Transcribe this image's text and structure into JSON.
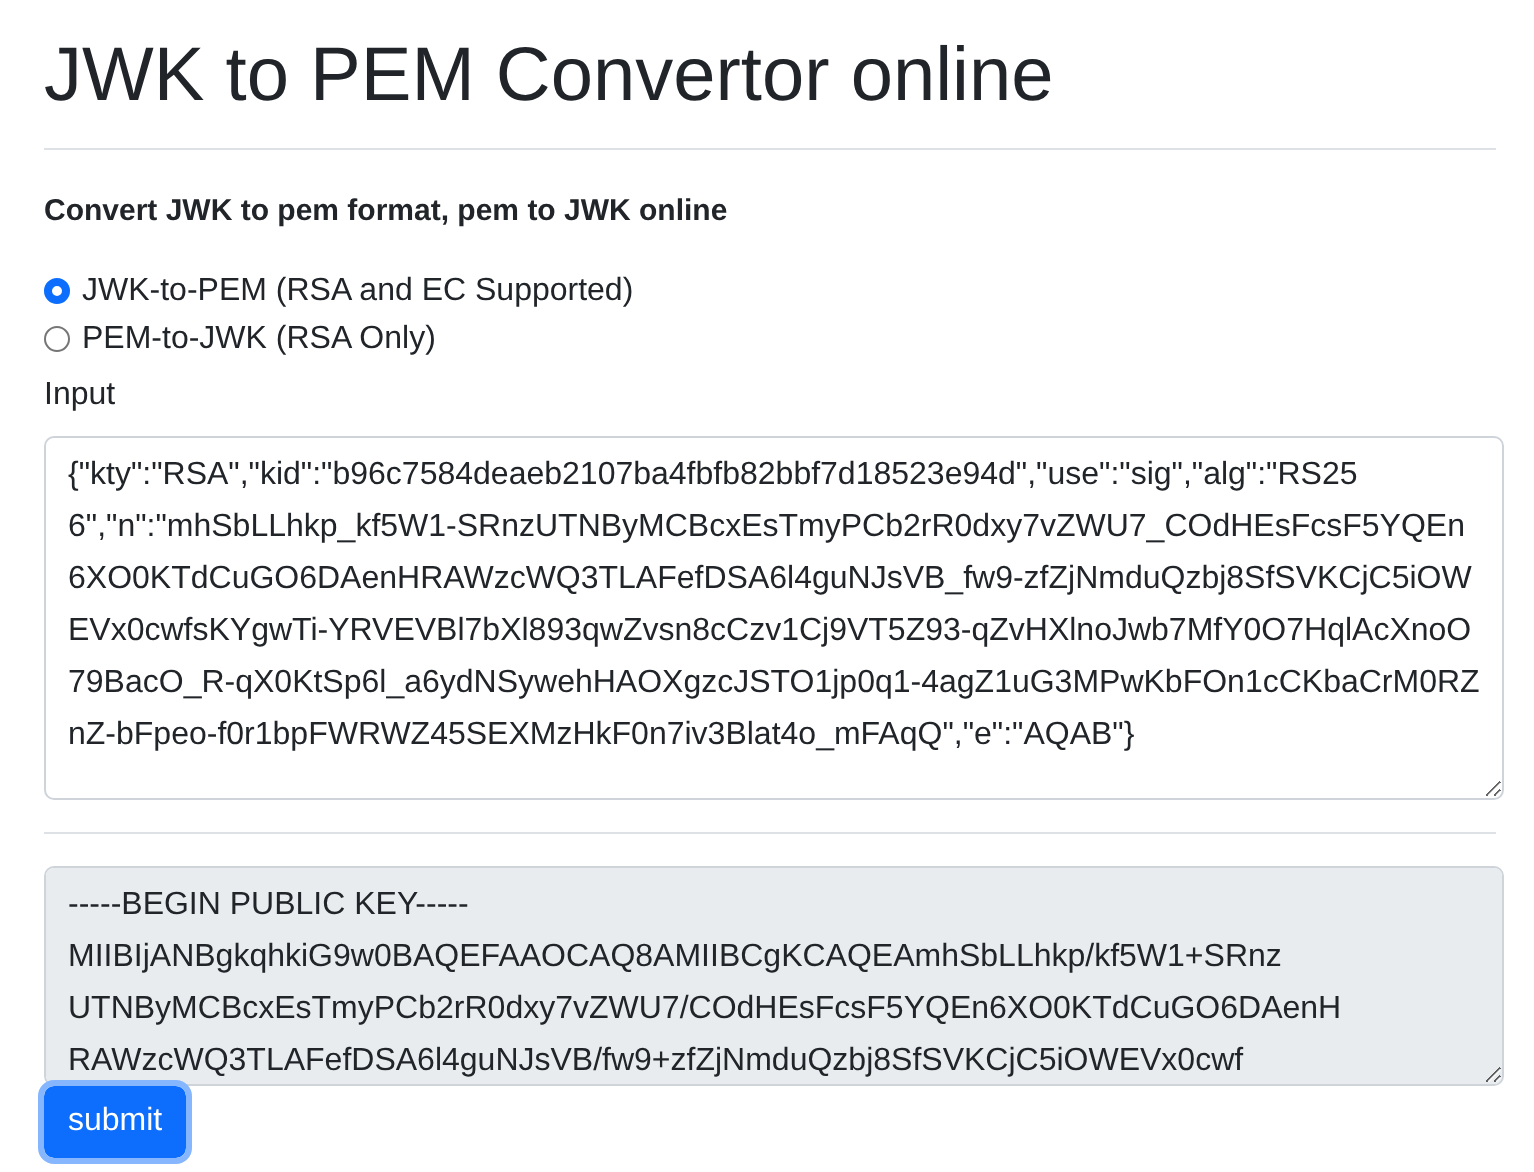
{
  "title": "JWK to PEM Convertor online",
  "subtitle": "Convert JWK to pem format, pem to JWK online",
  "modes": [
    {
      "label": "JWK-to-PEM (RSA and EC Supported)",
      "selected": true
    },
    {
      "label": "PEM-to-JWK (RSA Only)",
      "selected": false
    }
  ],
  "input_label": "Input",
  "input_value": "{\"kty\":\"RSA\",\"kid\":\"b96c7584deaeb2107ba4fbfb82bbf7d18523e94d\",\"use\":\"sig\",\"alg\":\"RS256\",\"n\":\"mhSbLLhkp_kf5W1-SRnzUTNByMCBcxEsTmyPCb2rR0dxy7vZWU7_COdHEsFcsF5YQEn6XO0KTdCuGO6DAenHRAWzcWQ3TLAFefDSA6l4guNJsVB_fw9-zfZjNmduQzbj8SfSVKCjC5iOWEVx0cwfsKYgwTi-YRVEVBl7bXl893qwZvsn8cCzv1Cj9VT5Z93-qZvHXlnoJwb7MfY0O7HqlAcXnoO79BacO_R-qX0KtSp6l_a6ydNSywehHAOXgzcJSTO1jp0q1-4agZ1uG3MPwKbFOn1cCKbaCrM0RZnZ-bFpeo-f0r1bpFWRWZ45SEXMzHkF0n7iv3Blat4o_mFAqQ\",\"e\":\"AQAB\"}",
  "output_lines": [
    "-----BEGIN PUBLIC KEY-----",
    "MIIBIjANBgkqhkiG9w0BAQEFAAOCAQ8AMIIBCgKCAQEAmhSbLLhkp/kf5W1+SRnz",
    "UTNByMCBcxEsTmyPCb2rR0dxy7vZWU7/COdHEsFcsF5YQEn6XO0KTdCuGO6DAenH",
    "RAWzcWQ3TLAFefDSA6l4guNJsVB/fw9+zfZjNmduQzbj8SfSVKCjC5iOWEVx0cwf"
  ],
  "submit": "submit"
}
